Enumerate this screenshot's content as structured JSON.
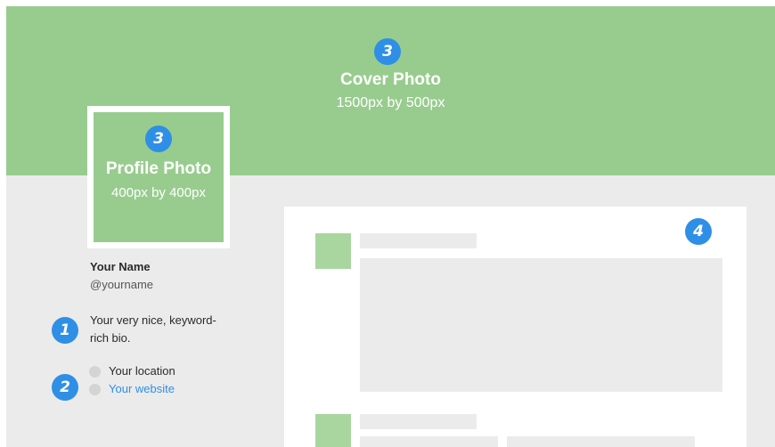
{
  "cover": {
    "badge": "3",
    "title": "Cover Photo",
    "dimensions": "1500px by 500px",
    "color": "#98cc8e"
  },
  "profile": {
    "badge": "3",
    "title": "Profile Photo",
    "dimensions": "400px by 400px"
  },
  "user": {
    "name": "Your Name",
    "handle": "@yourname",
    "bio_badge": "1",
    "bio": "Your very nice, keyword-rich bio.",
    "info_badge": "2",
    "location": "Your location",
    "website": "Your website"
  },
  "feed": {
    "badge": "4"
  },
  "colors": {
    "accent": "#2f8fe6",
    "background": "#ebebeb",
    "cover_green": "#98cc8e"
  }
}
